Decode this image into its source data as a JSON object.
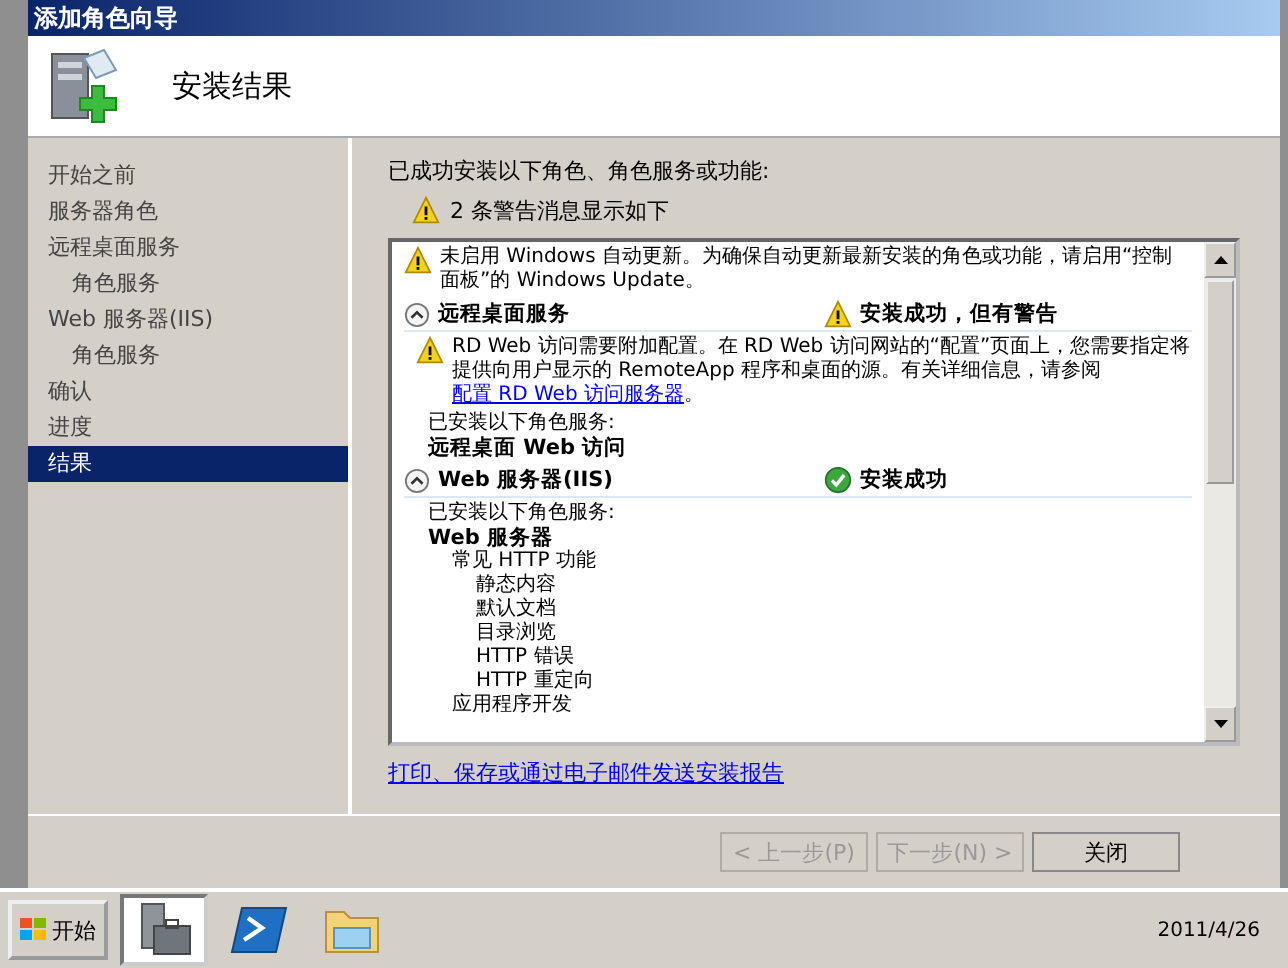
{
  "window": {
    "title": "添加角色向导"
  },
  "header": {
    "title": "安装结果"
  },
  "nav": [
    {
      "label": "开始之前",
      "selected": false
    },
    {
      "label": "服务器角色",
      "selected": false
    },
    {
      "label": "远程桌面服务",
      "selected": false,
      "children": [
        {
          "label": "角色服务",
          "selected": false
        }
      ]
    },
    {
      "label": "Web 服务器(IIS)",
      "selected": false,
      "children": [
        {
          "label": "角色服务",
          "selected": false
        }
      ]
    },
    {
      "label": "确认",
      "selected": false
    },
    {
      "label": "进度",
      "selected": false
    },
    {
      "label": "结果",
      "selected": true
    }
  ],
  "content": {
    "intro": "已成功安装以下角色、角色服务或功能:",
    "warning_summary": "2 条警告消息显示如下",
    "notice": "未启用 Windows 自动更新。为确保自动更新最新安装的角色或功能，请启用“控制面板”的 Windows Update。",
    "sections": [
      {
        "title": "远程桌面服务",
        "expanded": true,
        "status": "安装成功，但有警告",
        "kind": "warning",
        "message": "RD Web 访问需要附加配置。在 RD Web 访问网站的“配置”页面上，您需要指定将提供向用户显示的 RemoteApp 程序和桌面的源。有关详细信息，请参阅",
        "message_link": "配置 RD Web 访问服务器",
        "message_end": "。",
        "installed_label": "已安装以下角色服务:",
        "installed": [
          {
            "label": "远程桌面 Web 访问"
          }
        ]
      },
      {
        "title": "Web 服务器(IIS)",
        "expanded": true,
        "status": "安装成功",
        "kind": "success",
        "installed_label": "已安装以下角色服务:",
        "installed": [
          {
            "label": "Web 服务器",
            "children": [
              {
                "label": "常见 HTTP 功能",
                "children": [
                  {
                    "label": "静态内容"
                  },
                  {
                    "label": "默认文档"
                  },
                  {
                    "label": "目录浏览"
                  },
                  {
                    "label": "HTTP 错误"
                  },
                  {
                    "label": "HTTP 重定向"
                  }
                ]
              },
              {
                "label": "应用程序开发"
              }
            ]
          }
        ]
      }
    ],
    "report_link": "打印、保存或通过电子邮件发送安装报告"
  },
  "buttons": [
    {
      "label": "< 上一步(P)",
      "disabled": true
    },
    {
      "label": "下一步(N) >",
      "disabled": true
    },
    {
      "label": "关闭",
      "disabled": false
    }
  ],
  "taskbar": {
    "start": "开始",
    "apps": [
      {
        "kind": "server",
        "selected": true
      },
      {
        "kind": "shell",
        "selected": false
      },
      {
        "kind": "folder",
        "selected": false
      }
    ],
    "date": "2011/4/26"
  }
}
